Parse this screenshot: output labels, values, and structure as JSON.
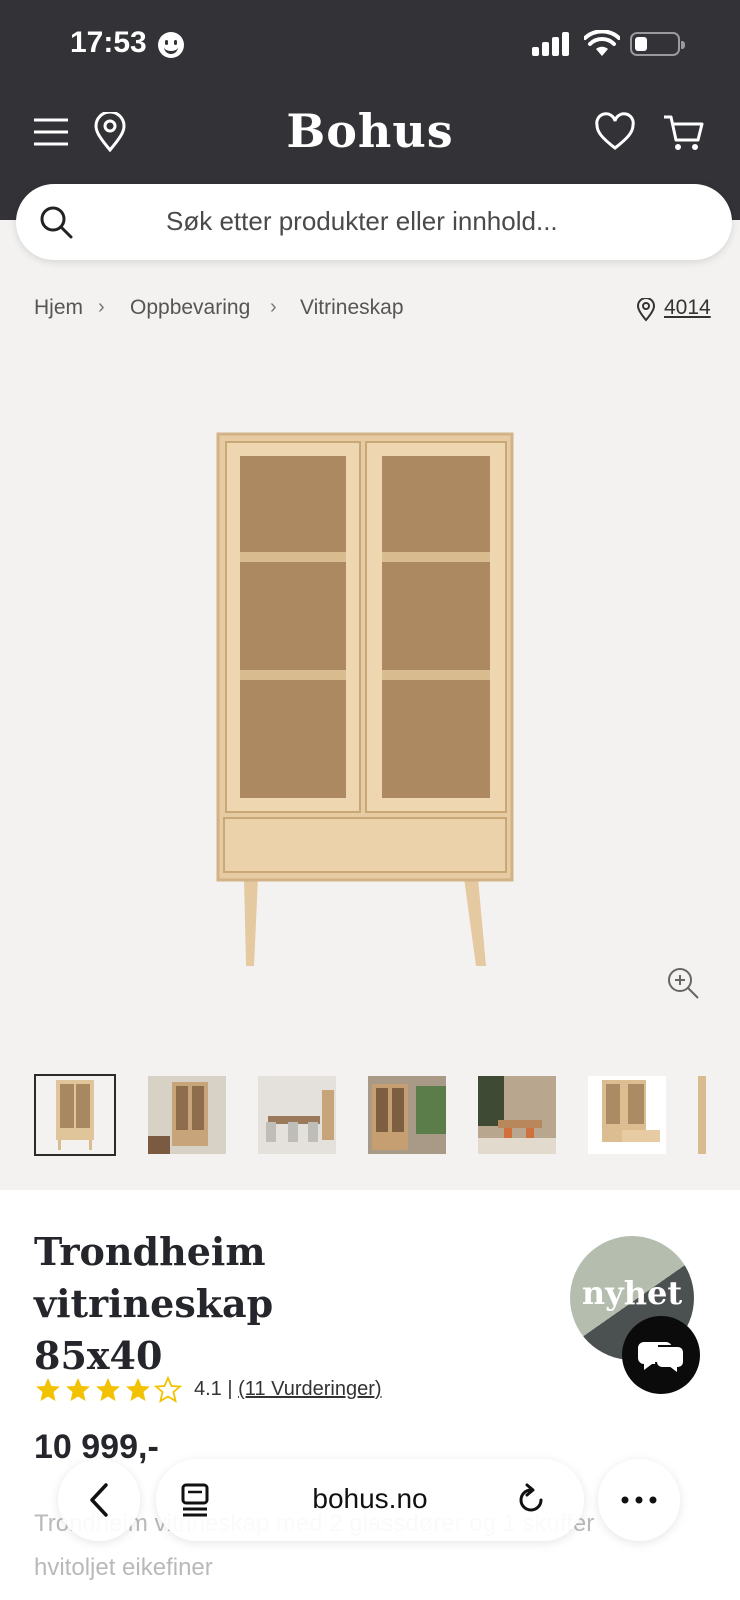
{
  "status_bar": {
    "time": "17:53"
  },
  "header": {
    "brand": "Bohus"
  },
  "search": {
    "placeholder": "Søk etter produkter eller innhold..."
  },
  "breadcrumbs": {
    "items": [
      "Hjem",
      "Oppbevaring",
      "Vitrineskap"
    ],
    "postal_code": "4014"
  },
  "gallery": {
    "thumbnail_count": 7,
    "active_index": 0
  },
  "product": {
    "title_line1": "Trondheim vitrineskap",
    "title_line2": "85x40",
    "badge": "nyhet",
    "rating_value": "4.1",
    "rating_separator": "|",
    "rating_count_text": "(11 Vurderinger)",
    "rating_stars": 4,
    "rating_max": 5,
    "price": "10 999,-",
    "description_line1": "Trondheim vitrineskap med 2 glassdører og 1 skuffer",
    "description_line2": "hvitoljet eikefiner"
  },
  "browser": {
    "url": "bohus.no"
  },
  "colors": {
    "header_bg": "#333237",
    "page_bg": "#f4f2f0",
    "star": "#f2c200",
    "badge_light": "#b4bdae",
    "badge_dark": "#4b5051"
  }
}
